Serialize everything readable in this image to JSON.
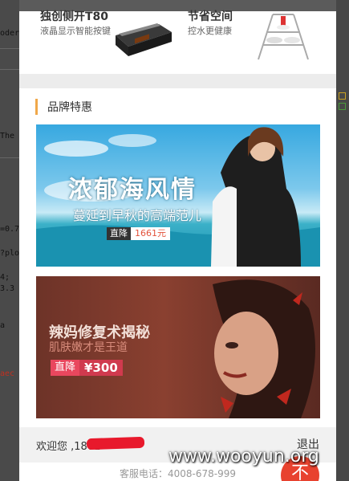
{
  "background": {
    "snippets": [
      "oder",
      "The",
      "=0.7",
      "?plo",
      "4;",
      "3.3",
      "a",
      "aec"
    ]
  },
  "promos": [
    {
      "title": "独创侧开T80",
      "subtitle": "液晶显示智能按键"
    },
    {
      "title": "节省空间",
      "subtitle": "控水更健康"
    }
  ],
  "section": {
    "title": "品牌特惠"
  },
  "banner1": {
    "title": "浓郁海风情",
    "subtitle": "蔓延到早秋的高端范儿",
    "price_label": "直降",
    "price_value": "1661元"
  },
  "banner2": {
    "title": "辣妈修复术揭秘",
    "subtitle": "肌肤嫩才是王道",
    "price_label": "直降",
    "price_value": "¥300"
  },
  "footer": {
    "welcome": "欢迎您 ,1861",
    "logout": "退出"
  },
  "hotline": "客服电话：4008-678-999",
  "fab": {
    "label": "不"
  },
  "watermark": "www.wooyun.org",
  "colors": {
    "accent": "#f0a84a",
    "red": "#e8422f"
  }
}
